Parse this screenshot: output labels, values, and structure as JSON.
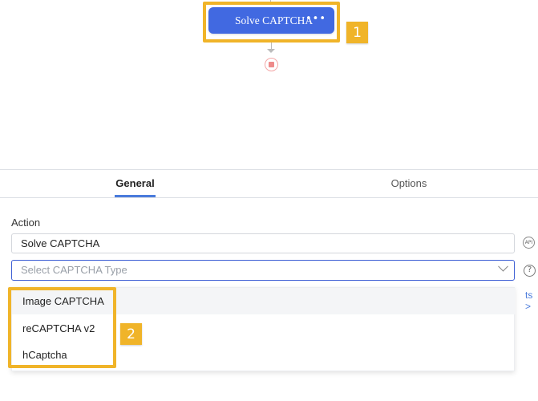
{
  "flow": {
    "node_label": "Solve CAPTCHA",
    "node_more": "•••",
    "badge_1": "1",
    "badge_2": "2"
  },
  "tabs": {
    "general": "General",
    "options": "Options"
  },
  "form": {
    "action_label": "Action",
    "action_value": "Solve CAPTCHA",
    "api_icon_text": "API",
    "captcha_placeholder": "Select CAPTCHA Type",
    "help_icon_text": "?",
    "link_partial": "ts >"
  },
  "dropdown": {
    "options": [
      "Image CAPTCHA",
      "reCAPTCHA v2",
      "hCaptcha"
    ]
  },
  "colors": {
    "node_blue": "#4169e1",
    "highlight_yellow": "#f0b429",
    "accent_blue": "#4a7bdc",
    "end_node_red": "#ee8a8a"
  }
}
